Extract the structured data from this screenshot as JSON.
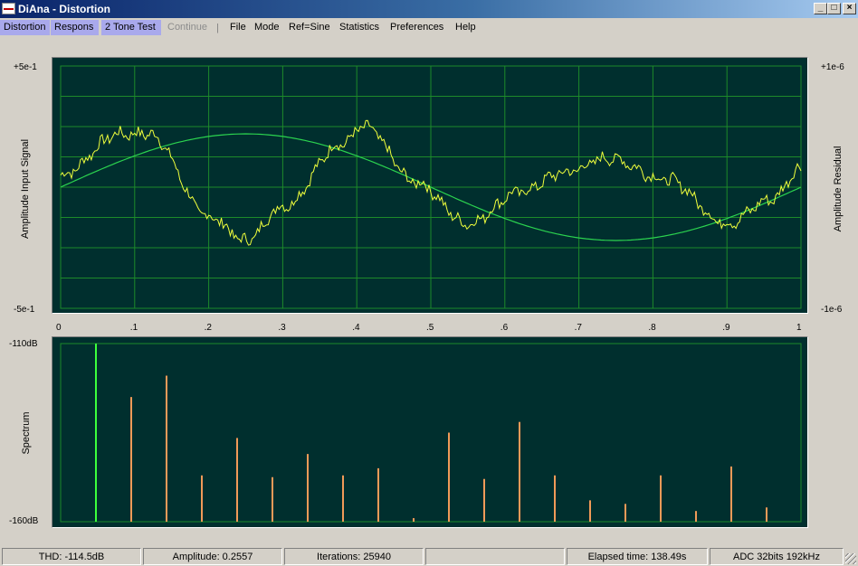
{
  "window": {
    "title": "DiAna - Distortion",
    "controls": {
      "minimize": "_",
      "maximize": "□",
      "close": "×"
    }
  },
  "menu": {
    "tools": [
      "Distortion",
      "Respons",
      "2 Tone Test"
    ],
    "continue": "Continue",
    "items": [
      "File",
      "Mode",
      "Ref=Sine",
      "Statistics",
      "Preferences",
      "Help"
    ]
  },
  "upper_plot": {
    "left_top": "+5e-1",
    "left_bottom": "-5e-1",
    "right_top": "+1e-6",
    "right_bottom": "-1e-6",
    "left_axis_label": "Amplitude Input Signal",
    "right_axis_label": "Amplitude Residual",
    "x_ticks": [
      "0",
      ".1",
      ".2",
      ".3",
      ".4",
      ".5",
      ".6",
      ".7",
      ".8",
      ".9",
      "1"
    ]
  },
  "lower_plot": {
    "top_label": "-110dB",
    "bottom_label": "-160dB",
    "axis_label": "Spectrum"
  },
  "status": {
    "thd": "THD: -114.5dB",
    "amplitude": "Amplitude: 0.2557",
    "iterations": "Iterations: 25940",
    "blank": "",
    "elapsed": "Elapsed time: 138.49s",
    "adc": "ADC 32bits 192kHz"
  },
  "colors": {
    "plot_bg": "#002f2e",
    "grid": "#1d8a2a",
    "sine": "#2bd34f",
    "residual": "#f0ff3c",
    "fundamental": "#3cff3c",
    "harmonics": "#f09a58",
    "tool_highlight": "#a9a9ec"
  },
  "chart_data": [
    {
      "type": "line",
      "x_range": [
        0,
        1
      ],
      "series": [
        {
          "kind": "sine reference",
          "x": [
            0,
            0.25,
            0.5,
            0.75,
            1
          ],
          "y": [
            0,
            0.22,
            0,
            -0.22,
            0
          ]
        },
        {
          "kind": "residual",
          "x": [
            0,
            0.08,
            0.12,
            0.2,
            0.25,
            0.3,
            0.38,
            0.41,
            0.48,
            0.55,
            0.62,
            0.68,
            0.74,
            0.82,
            0.9,
            0.96,
            1
          ],
          "y": [
            0.05,
            0.22,
            0.22,
            -0.12,
            -0.22,
            -0.08,
            0.18,
            0.25,
            0.02,
            -0.15,
            -0.02,
            0.06,
            0.12,
            0.03,
            -0.15,
            -0.05,
            0.08
          ]
        }
      ]
    },
    {
      "type": "bar",
      "ylim_db": [
        -160,
        -110
      ],
      "bins": [
        1,
        2,
        3,
        4,
        5,
        6,
        7,
        8,
        9,
        10,
        11,
        12,
        13,
        14,
        15,
        16,
        17,
        18,
        19,
        20
      ],
      "values_db": [
        -110,
        -125,
        -119,
        -147,
        -136.5,
        -147.5,
        -141,
        -147,
        -145,
        -159,
        -135,
        -148,
        -132,
        -147,
        -154,
        -155,
        -147,
        -157,
        -144.5,
        -156
      ]
    }
  ]
}
